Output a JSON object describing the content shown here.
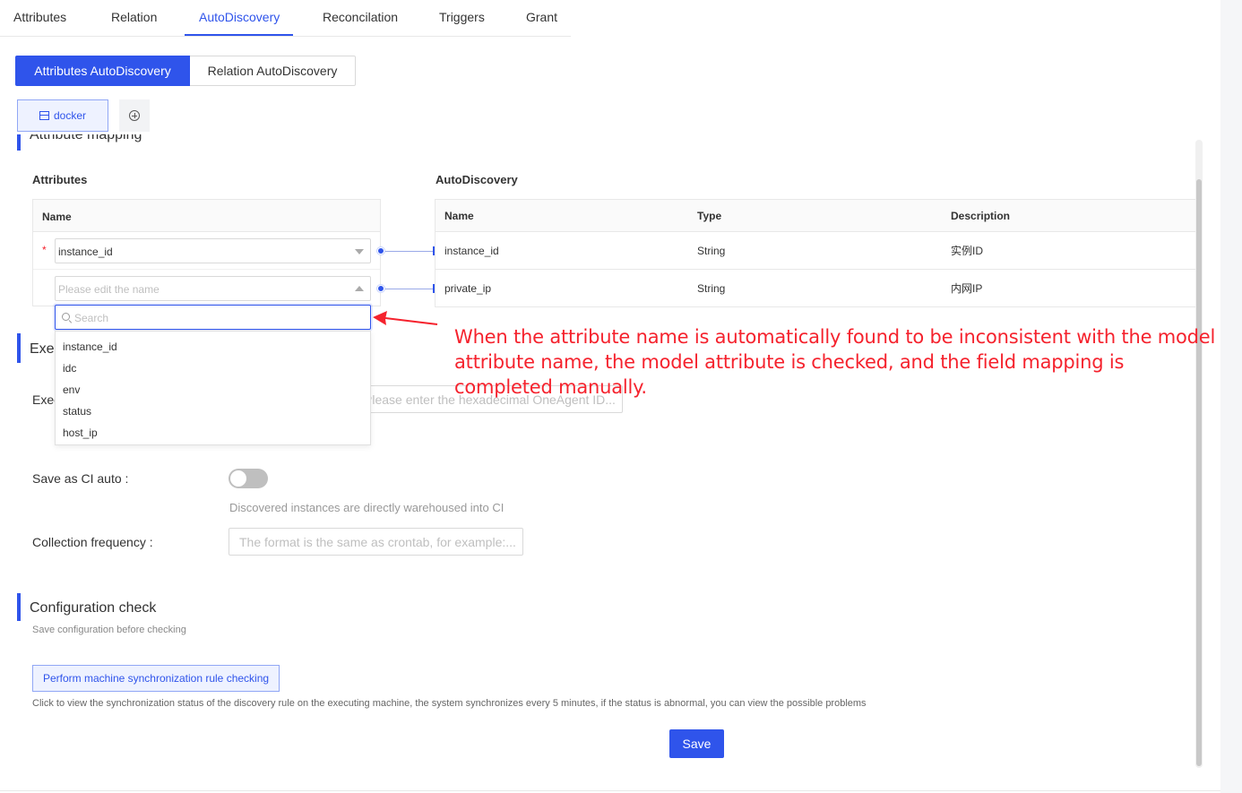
{
  "top_tabs": [
    "Attributes",
    "Relation",
    "AutoDiscovery",
    "Reconcilation",
    "Triggers",
    "Grant"
  ],
  "top_tabs_active": "AutoDiscovery",
  "segments": {
    "attributes": "Attributes AutoDiscovery",
    "relation": "Relation AutoDiscovery"
  },
  "docker_tab": {
    "label": "docker",
    "icon": "table-icon"
  },
  "add_tab_icon": "plus-circle-icon",
  "mapping": {
    "section_title": "Attribute mapping",
    "attributes_title": "Attributes",
    "autodiscovery_title": "AutoDiscovery",
    "left_table": {
      "header": "Name",
      "rows": [
        {
          "value": "instance_id",
          "required": "*"
        },
        {
          "placeholder": "Please edit the name"
        }
      ]
    },
    "right_table": {
      "headers": [
        "Name",
        "Type",
        "Description"
      ],
      "rows": [
        [
          "instance_id",
          "String",
          "实例ID"
        ],
        [
          "private_ip",
          "String",
          "内网IP"
        ]
      ]
    },
    "dropdown": {
      "search_placeholder": "Search",
      "options": [
        "instance_id",
        "idc",
        "env",
        "status",
        "host_ip"
      ]
    }
  },
  "execution": {
    "section_title_visible": "Exec",
    "label_visible": "Exec",
    "input_placeholder": "Please enter the hexadecimal OneAgent ID..."
  },
  "save_ci": {
    "label": "Save as CI auto",
    "toggle_on": false,
    "hint": "Discovered instances are directly warehoused into CI"
  },
  "collection": {
    "label": "Collection frequency",
    "placeholder": "The format is the same as crontab, for example:..."
  },
  "config_check": {
    "title": "Configuration check",
    "subtitle": "Save configuration before checking",
    "button": "Perform machine synchronization rule checking",
    "hint": "Click to view the synchronization status of the discovery rule on the executing machine, the system synchronizes every 5 minutes, if the status is abnormal, you can view the possible problems"
  },
  "save_button": "Save",
  "annotation": "When the attribute name is automatically found to be inconsistent with the model attribute name, the model attribute is checked, and the field mapping is completed manually.",
  "colors": {
    "primary": "#2f54eb",
    "annotation": "#f5222d",
    "required": "#f5222d"
  }
}
